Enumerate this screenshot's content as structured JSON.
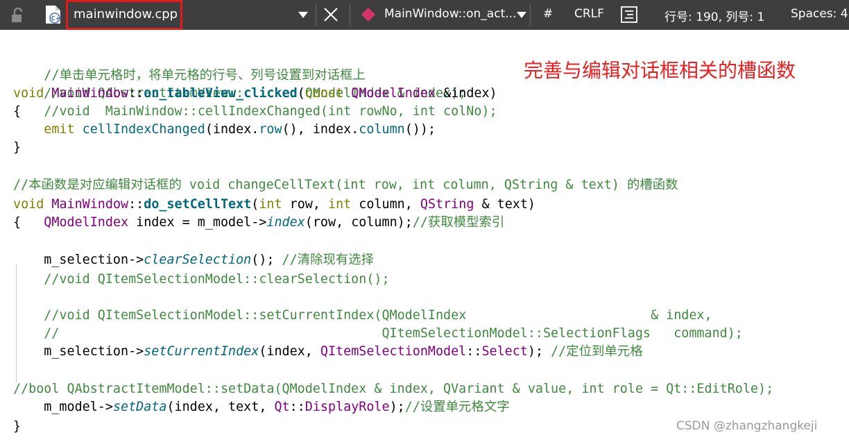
{
  "toolbar": {
    "file_name": "mainwindow.cpp",
    "function_name": "MainWindow::on_act...",
    "hash_label": "#",
    "line_ending": "CRLF",
    "position": "行号: 190, 列号: 1",
    "indent": "Spaces: 4"
  },
  "colors": {
    "toolbar_bg": "#3e3e3e",
    "highlight_border": "#e21a1a",
    "annotation": "#e82020",
    "comment": "#3f8a3f",
    "keyword": "#808000",
    "type": "#800080",
    "function": "#00677c"
  },
  "icons": {
    "lock": "lock-icon",
    "file": "cpp-file-icon",
    "file_dropdown": "chevron-down-icon",
    "close": "close-icon",
    "function": "diamond-function-icon",
    "function_dropdown": "chevron-down-icon",
    "format": "format-icon"
  },
  "annotation": "完善与编辑对话框相关的槽函数",
  "watermark": "CSDN @zhangzhangkeji",
  "code": {
    "l1": [
      "//单击单元格时，将单元格的行号、列号设置到对话框上"
    ],
    "l2": [
      "//void QAbstractItemView::clicked(QModelIndex & index);"
    ],
    "l3": [
      "void",
      " ",
      "MainWindow",
      "::",
      "on_tableView_clicked",
      "(",
      "const",
      " ",
      "QModelIndex",
      " &index)"
    ],
    "l4": [
      "{",
      "   ",
      "//void  MainWindow::cellIndexChanged(int rowNo, int colNo);"
    ],
    "l5": [
      "    ",
      "emit",
      " ",
      "cellIndexChanged",
      "(index.",
      "row",
      "(), index.",
      "column",
      "());"
    ],
    "l6": [
      "}"
    ],
    "l7": [
      "//本函数是对应编辑对话框的 void changeCellText(int row, int column, QString & text) 的槽函数"
    ],
    "l8": [
      "void",
      " ",
      "MainWindow",
      "::",
      "do_setCellText",
      "(",
      "int",
      " row, ",
      "int",
      " column, ",
      "QString",
      " & text)"
    ],
    "l9": [
      "{",
      "   ",
      "QModelIndex",
      " index = m_model->",
      "index",
      "(row, column);",
      "//获取模型索引"
    ],
    "l10": [
      "    m_selection->",
      "clearSelection",
      "(); ",
      "//清除现有选择"
    ],
    "l11": [
      "    ",
      "//void QItemSelectionModel::clearSelection();"
    ],
    "l12": [
      "    ",
      "//void QItemSelectionModel::setCurrentIndex(QModelIndex                        & index,"
    ],
    "l13": [
      "    ",
      "//                                          QItemSelectionModel::SelectionFlags   command);"
    ],
    "l14": [
      "    m_selection->",
      "setCurrentIndex",
      "(index, ",
      "QItemSelectionModel",
      "::",
      "Select",
      "); ",
      "//定位到单元格"
    ],
    "l15": [
      "//bool QAbstractItemModel::setData(QModelIndex & index, QVariant & value, int role = Qt::EditRole);"
    ],
    "l16": [
      "    m_model->",
      "setData",
      "(index, text, ",
      "Qt",
      "::",
      "DisplayRole",
      ");",
      "//设置单元格文字"
    ],
    "l17": [
      "}"
    ]
  }
}
